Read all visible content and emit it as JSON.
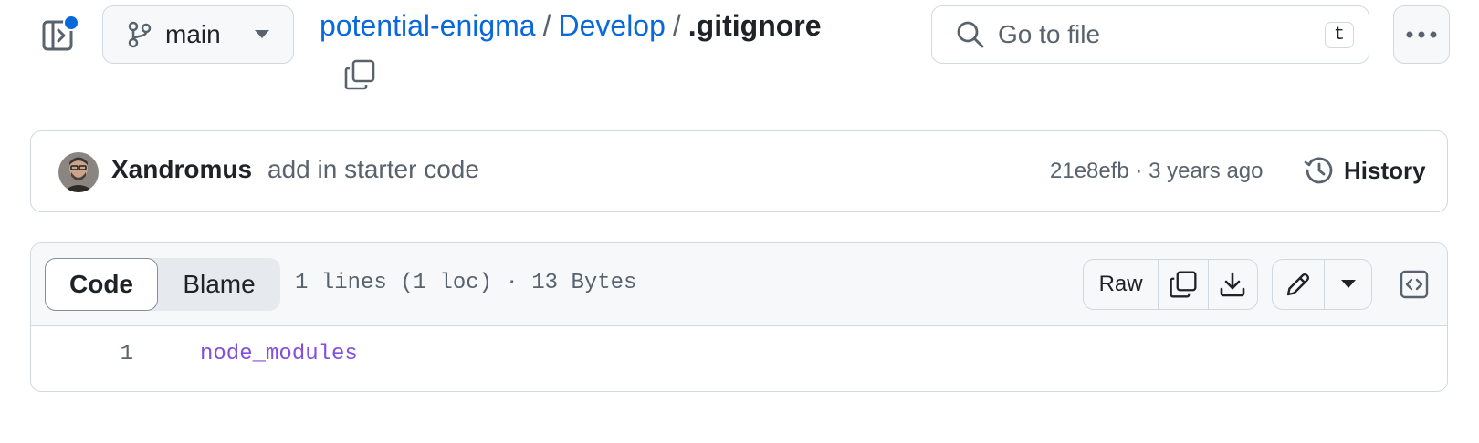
{
  "header": {
    "branch": "main",
    "breadcrumb": {
      "repo": "potential-enigma",
      "folder": "Develop",
      "separator": "/",
      "file": ".gitignore"
    },
    "search": {
      "placeholder": "Go to file",
      "shortcut": "t"
    }
  },
  "commit": {
    "author": "Xandromus",
    "message": "add in starter code",
    "sha_time": "21e8efb · 3 years ago",
    "history_label": "History"
  },
  "file": {
    "tabs": [
      "Code",
      "Blame"
    ],
    "info": "1 lines (1 loc) · 13 Bytes",
    "raw_label": "Raw",
    "lines": [
      {
        "number": "1",
        "text": "node_modules"
      }
    ]
  },
  "icons": {
    "sidebar": "sidebar-expand-icon",
    "branch": "git-branch-icon",
    "copy": "copy-icon",
    "search": "search-icon",
    "more": "kebab-horizontal-icon",
    "history": "history-icon",
    "download": "download-icon",
    "edit": "pencil-icon",
    "symbols": "code-square-icon"
  },
  "colors": {
    "link": "#0969da",
    "muted": "#59636e",
    "notification_dot": "#0969da",
    "code_token": "#8250df"
  }
}
